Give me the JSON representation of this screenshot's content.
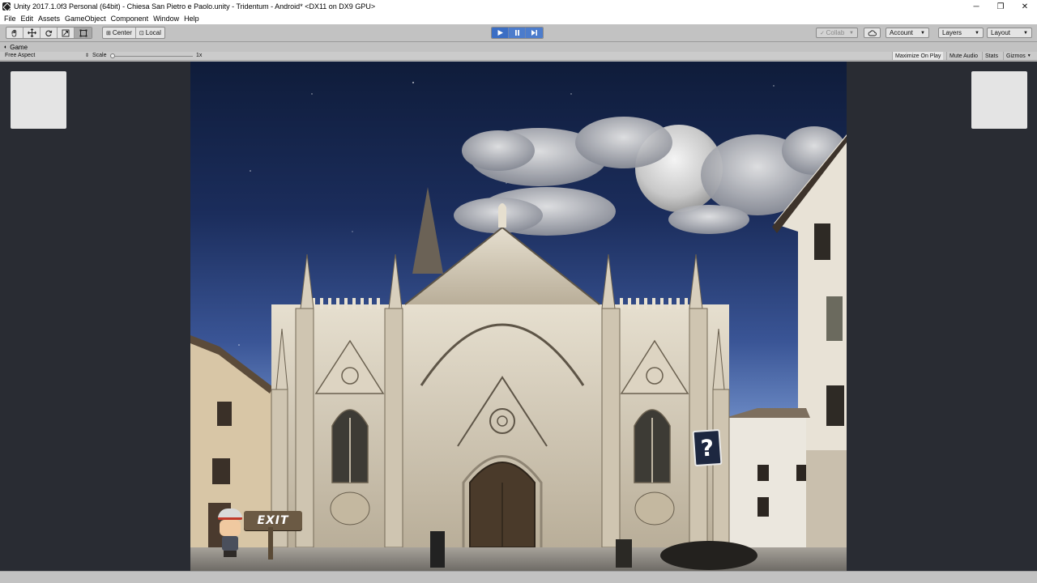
{
  "window": {
    "title": "Unity 2017.1.0f3 Personal (64bit) - Chiesa San Pietro e Paolo.unity - Tridentum - Android* <DX11 on DX9 GPU>",
    "controls": {
      "minimize": "─",
      "restore": "❐",
      "close": "✕"
    }
  },
  "menu": {
    "items": [
      "File",
      "Edit",
      "Assets",
      "GameObject",
      "Component",
      "Window",
      "Help"
    ]
  },
  "toolbar": {
    "transform_tools": [
      "hand-icon",
      "move-icon",
      "rotate-icon",
      "scale-icon",
      "rect-tool-icon"
    ],
    "pivot": {
      "center_label": "Center",
      "local_label": "Local"
    },
    "playback": [
      "play-icon",
      "pause-icon",
      "step-icon"
    ],
    "collab_label": "Collab",
    "account_label": "Account",
    "layers_label": "Layers",
    "layout_label": "Layout"
  },
  "game_view": {
    "tab_label": "Game",
    "aspect_label": "Free Aspect",
    "scale_label": "Scale",
    "scale_value": "1x",
    "buttons": {
      "maximize": "Maximize On Play",
      "mute": "Mute Audio",
      "stats": "Stats",
      "gizmos": "Gizmos"
    }
  },
  "scene": {
    "exit_label": "EXIT",
    "help_label": "?",
    "colors": {
      "sky_top": "#0f1c3a",
      "sky_bottom": "#9ab1d8",
      "facade": "#d9d0bd",
      "accent": "#4c7ccc"
    }
  }
}
